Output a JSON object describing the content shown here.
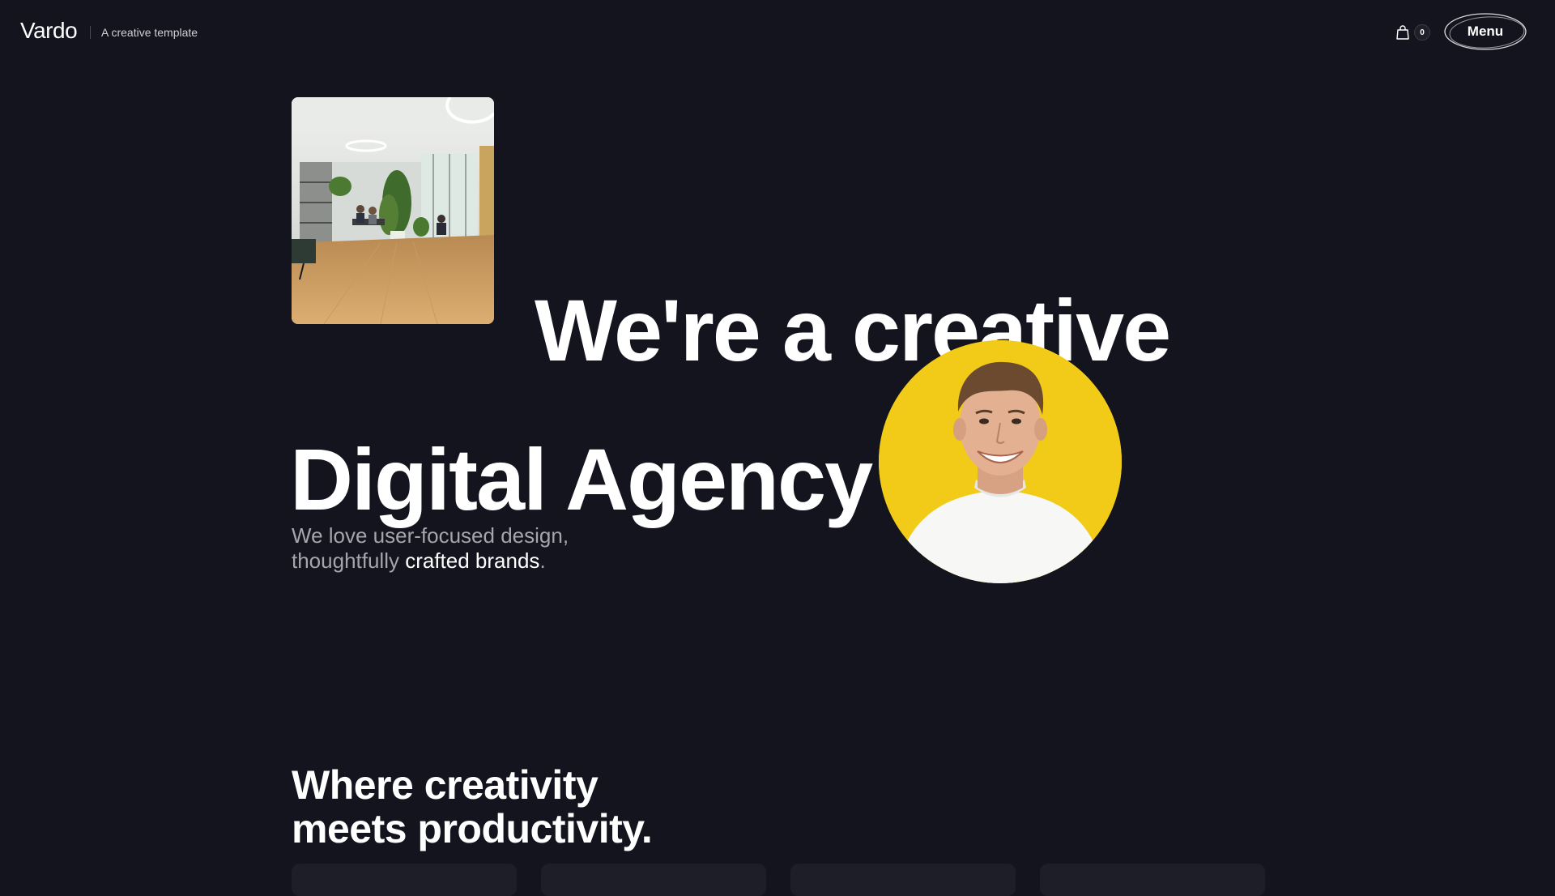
{
  "header": {
    "logo": "Vardo",
    "tagline": "A creative template",
    "cart_count": "0",
    "menu_label": "Menu"
  },
  "hero": {
    "headline_line1": "We're a creative",
    "headline_line2": "Digital Agency",
    "lead_part1": "We love user-focused design,",
    "lead_part2": "thoughtfully ",
    "lead_highlight": "crafted brands",
    "lead_end": "."
  },
  "section": {
    "title_line1": "Where creativity",
    "title_line2": "meets productivity."
  },
  "icons": {
    "cart": "shopping-bag-icon"
  },
  "colors": {
    "background": "#13141d",
    "text": "#ffffff",
    "muted_text": "#a4a5ad",
    "avatar_background": "#f2cb18"
  }
}
